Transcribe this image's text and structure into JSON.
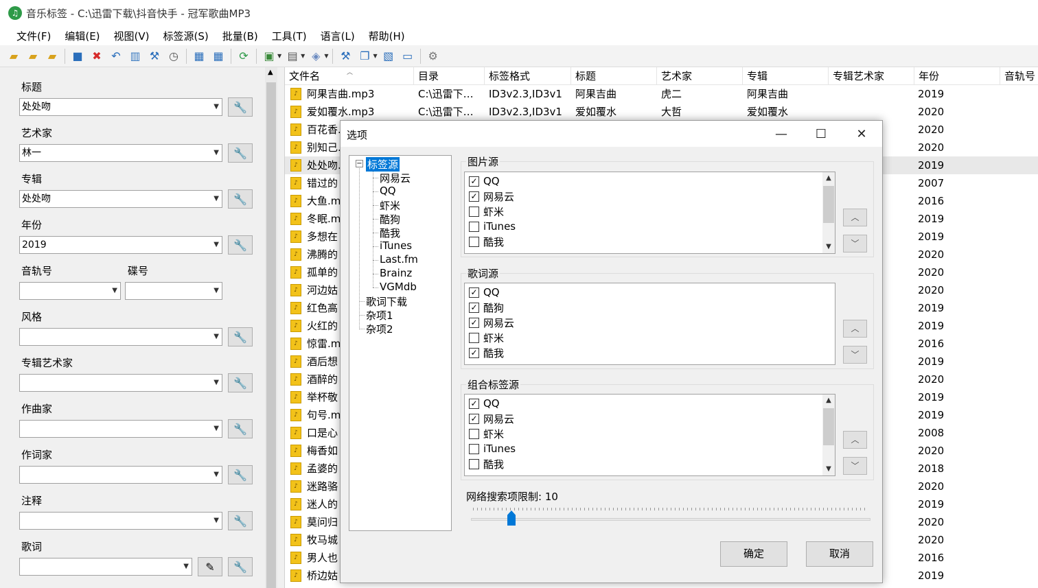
{
  "window": {
    "title": "音乐标签 - C:\\迅雷下载\\抖音快手 - 冠军歌曲MP3",
    "app_icon": "♫"
  },
  "menu": [
    "文件(F)",
    "编辑(E)",
    "视图(V)",
    "标签源(S)",
    "批量(B)",
    "工具(T)",
    "语言(L)",
    "帮助(H)"
  ],
  "left_panel": {
    "title_label": "标题",
    "title_value": "处处吻",
    "artist_label": "艺术家",
    "artist_value": "林一",
    "album_label": "专辑",
    "album_value": "处处吻",
    "year_label": "年份",
    "year_value": "2019",
    "track_label": "音轨号",
    "disc_label": "碟号",
    "genre_label": "风格",
    "album_artist_label": "专辑艺术家",
    "composer_label": "作曲家",
    "lyricist_label": "作词家",
    "comment_label": "注释",
    "lyrics_label": "歌词"
  },
  "list": {
    "headers": [
      "文件名",
      "目录",
      "标签格式",
      "标题",
      "艺术家",
      "专辑",
      "专辑艺术家",
      "年份",
      "音轨号"
    ],
    "rows": [
      {
        "file": "阿果吉曲.mp3",
        "dir": "C:\\迅雷下…",
        "fmt": "ID3v2.3,ID3v1",
        "title": "阿果吉曲",
        "artist": "虎二",
        "album": "阿果吉曲",
        "year": "2019"
      },
      {
        "file": "爱如覆水.mp3",
        "dir": "C:\\迅雷下…",
        "fmt": "ID3v2.3,ID3v1",
        "title": "爱如覆水",
        "artist": "大哲",
        "album": "爱如覆水",
        "year": "2020"
      },
      {
        "file": "百花香.",
        "year": "2020"
      },
      {
        "file": "别知己.",
        "year": "2020"
      },
      {
        "file": "处处吻.",
        "year": "2019"
      },
      {
        "file": "错过的",
        "year": "2007"
      },
      {
        "file": "大鱼.m",
        "year": "2016"
      },
      {
        "file": "冬眠.m",
        "year": "2019"
      },
      {
        "file": "多想在",
        "year": "2019"
      },
      {
        "file": "沸腾的",
        "year": "2020"
      },
      {
        "file": "孤单的",
        "year": "2020"
      },
      {
        "file": "河边姑",
        "year": "2020"
      },
      {
        "file": "红色高",
        "year": "2019"
      },
      {
        "file": "火红的",
        "year": "2019"
      },
      {
        "file": "惊雷.m",
        "year": "2016"
      },
      {
        "file": "酒后想",
        "year": "2019"
      },
      {
        "file": "酒醉的",
        "year": "2020"
      },
      {
        "file": "举杯敬",
        "year": "2019"
      },
      {
        "file": "句号.m",
        "year": "2019"
      },
      {
        "file": "口是心",
        "year": "2008"
      },
      {
        "file": "梅香如",
        "year": "2020"
      },
      {
        "file": "孟婆的",
        "year": "2018"
      },
      {
        "file": "迷路骆",
        "year": "2020"
      },
      {
        "file": "迷人的",
        "year": "2019"
      },
      {
        "file": "莫问归",
        "year": "2020"
      },
      {
        "file": "牧马城",
        "year": "2020"
      },
      {
        "file": "男人也",
        "year": "2016"
      },
      {
        "file": "桥边姑",
        "year": "2019"
      }
    ]
  },
  "dialog": {
    "title": "选项",
    "tree": {
      "root": "标签源",
      "children": [
        "网易云",
        "QQ",
        "虾米",
        "酷狗",
        "酷我",
        "iTunes",
        "Last.fm",
        "Brainz",
        "VGMdb"
      ],
      "others": [
        "歌词下载",
        "杂项1",
        "杂项2"
      ]
    },
    "image_source": {
      "title": "图片源",
      "items": [
        {
          "label": "QQ",
          "checked": true
        },
        {
          "label": "网易云",
          "checked": true
        },
        {
          "label": "虾米",
          "checked": false
        },
        {
          "label": "iTunes",
          "checked": false
        },
        {
          "label": "酷我",
          "checked": false
        }
      ]
    },
    "lyrics_source": {
      "title": "歌词源",
      "items": [
        {
          "label": "QQ",
          "checked": true
        },
        {
          "label": "酷狗",
          "checked": true
        },
        {
          "label": "网易云",
          "checked": true
        },
        {
          "label": "虾米",
          "checked": false
        },
        {
          "label": "酷我",
          "checked": true
        }
      ]
    },
    "combined_source": {
      "title": "组合标签源",
      "items": [
        {
          "label": "QQ",
          "checked": true
        },
        {
          "label": "网易云",
          "checked": true
        },
        {
          "label": "虾米",
          "checked": false
        },
        {
          "label": "iTunes",
          "checked": false
        },
        {
          "label": "酷我",
          "checked": false
        }
      ]
    },
    "search_limit_label": "网络搜索项限制: 10",
    "search_limit_value": 10,
    "ok_label": "确定",
    "cancel_label": "取消"
  },
  "colors": {
    "accent": "#0078d7",
    "mp3_icon": "#f2c21a"
  }
}
